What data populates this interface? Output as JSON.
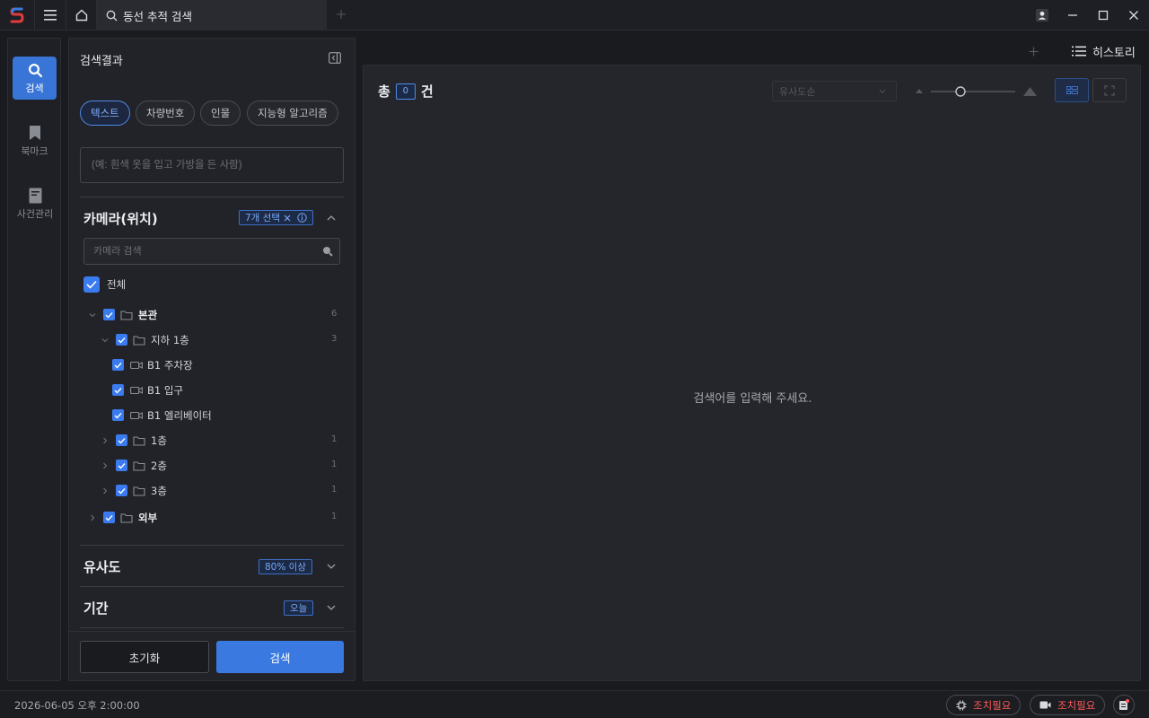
{
  "titlebar": {
    "tab_title": "동선 추적 검색"
  },
  "nav": {
    "items": [
      {
        "label": "검색",
        "icon": "search-icon"
      },
      {
        "label": "북마크",
        "icon": "bookmark-icon"
      },
      {
        "label": "사건관리",
        "icon": "document-icon"
      }
    ]
  },
  "panel": {
    "title": "검색결과",
    "chips": [
      "텍스트",
      "차량번호",
      "인물",
      "지능형 알고리즘"
    ],
    "text_placeholder": "(예: 흰색 옷을 입고 가방을 든 사람)",
    "camera": {
      "title": "카메라(위치)",
      "badge": "7개 선택",
      "search_placeholder": "카메라 검색",
      "all_label": "전체",
      "tree": [
        {
          "label": "본관",
          "count": "6"
        },
        {
          "label": "지하 1층",
          "count": "3"
        },
        {
          "label": "B1 주차장"
        },
        {
          "label": "B1 입구"
        },
        {
          "label": "B1 엘리베이터"
        },
        {
          "label": "1층",
          "count": "1"
        },
        {
          "label": "2층",
          "count": "1"
        },
        {
          "label": "3층",
          "count": "1"
        },
        {
          "label": "외부",
          "count": "1"
        }
      ]
    },
    "similarity": {
      "title": "유사도",
      "badge": "80% 이상"
    },
    "period": {
      "title": "기간",
      "badge": "오늘"
    },
    "reset_label": "초기화",
    "search_label": "검색"
  },
  "results": {
    "history_label": "히스토리",
    "total_prefix": "총",
    "count": "0",
    "total_suffix": "건",
    "sort_placeholder": "유사도순",
    "empty_message": "검색어를 입력해 주세요."
  },
  "status": {
    "datetime": "2026-06-05  오후 2:00:00",
    "alert1": "조치필요",
    "alert2": "조치필요"
  },
  "colors": {
    "accent": "#3a7ae0",
    "alert": "#ff5a5a"
  }
}
